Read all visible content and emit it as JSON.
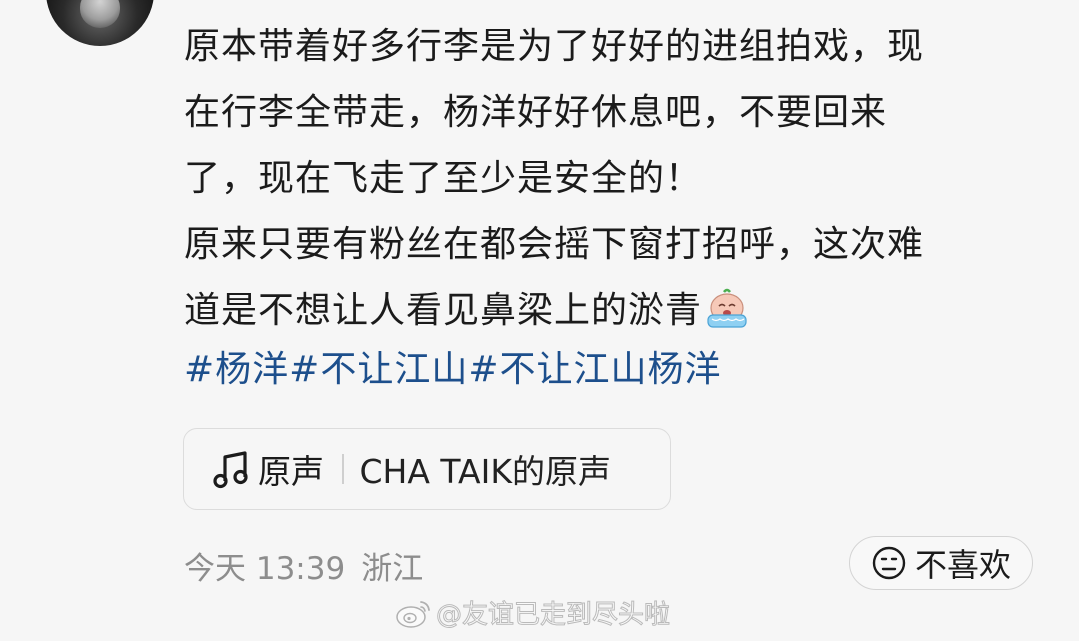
{
  "post": {
    "lines": [
      "原本带着好多行李是为了好好的进组拍戏，现",
      "在行李全带走，杨洋好好休息吧，不要回来",
      "了，现在飞走了至少是安全的！",
      "原来只要有粉丝在都会摇下窗打招呼，这次难",
      "道是不想让人看见鼻梁上的淤青"
    ],
    "emoji": "crying-emoji",
    "hashtags": [
      "#杨洋",
      "#不让江山",
      "#不让江山杨洋"
    ]
  },
  "audio": {
    "icon": "music-note-icon",
    "label": "原声",
    "track": "CHA TAIK的原声"
  },
  "meta": {
    "time": "今天 13:39",
    "location": "浙江"
  },
  "dislike": {
    "icon": "frown-face-icon",
    "label": "不喜欢"
  },
  "watermark": {
    "icon": "weibo-logo-icon",
    "text": "@友谊已走到尽头啦"
  },
  "colors": {
    "background": "#f6f6f6",
    "text": "#1b1b1b",
    "hashtag": "#1d4f8c",
    "meta": "#8d8d8d"
  }
}
